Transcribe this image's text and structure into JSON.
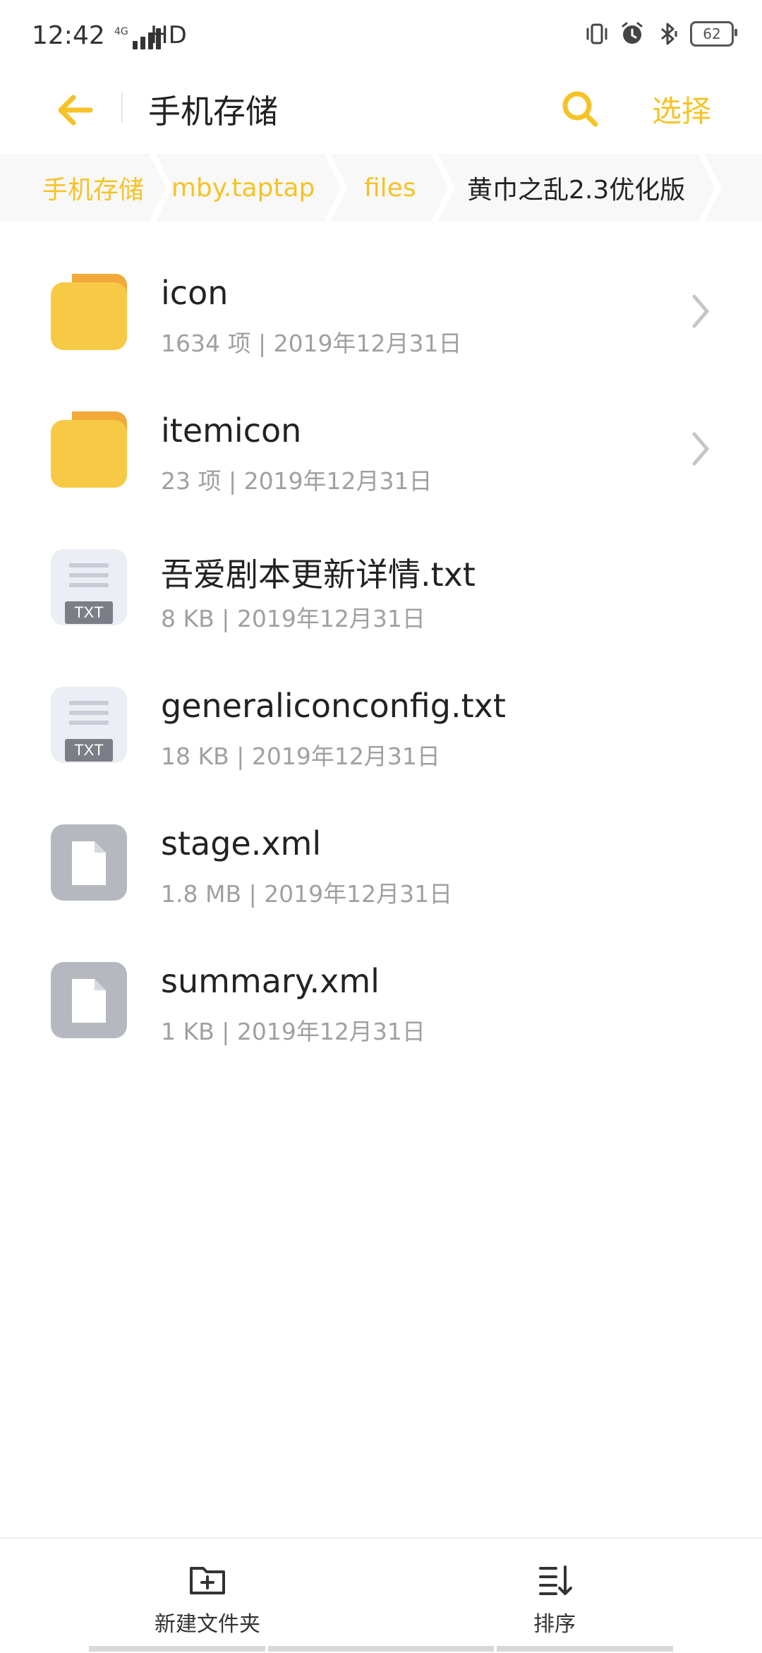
{
  "status_bar": {
    "time": "12:42",
    "network_tag": "4G",
    "hd_label": "HD",
    "battery_level": "62",
    "icons": [
      "vibrate-icon",
      "alarm-icon",
      "bluetooth-icon",
      "battery-icon"
    ]
  },
  "toolbar": {
    "title": "手机存储",
    "select_label": "选择"
  },
  "breadcrumb": {
    "items": [
      "手机存储",
      "nmby.taptap",
      "files",
      "黄巾之乱2.3优化版"
    ]
  },
  "files": [
    {
      "name": "icon",
      "meta": "1634 项 | 2019年12月31日",
      "type": "folder"
    },
    {
      "name": "itemicon",
      "meta": "23 项 | 2019年12月31日",
      "type": "folder"
    },
    {
      "name": "吾爱剧本更新详情.txt",
      "meta": "8 KB | 2019年12月31日",
      "type": "txt",
      "badge": "TXT"
    },
    {
      "name": "generaliconconfig.txt",
      "meta": "18 KB | 2019年12月31日",
      "type": "txt",
      "badge": "TXT"
    },
    {
      "name": "stage.xml",
      "meta": "1.8 MB | 2019年12月31日",
      "type": "file"
    },
    {
      "name": "summary.xml",
      "meta": "1 KB | 2019年12月31日",
      "type": "file"
    }
  ],
  "bottom_bar": {
    "new_folder_label": "新建文件夹",
    "sort_label": "排序"
  },
  "colors": {
    "accent": "#f5c327",
    "folder": "#f7ca45",
    "folder_tab": "#f3a83a",
    "txt_bg": "#eceef5",
    "file_bg": "#b5b8be"
  }
}
